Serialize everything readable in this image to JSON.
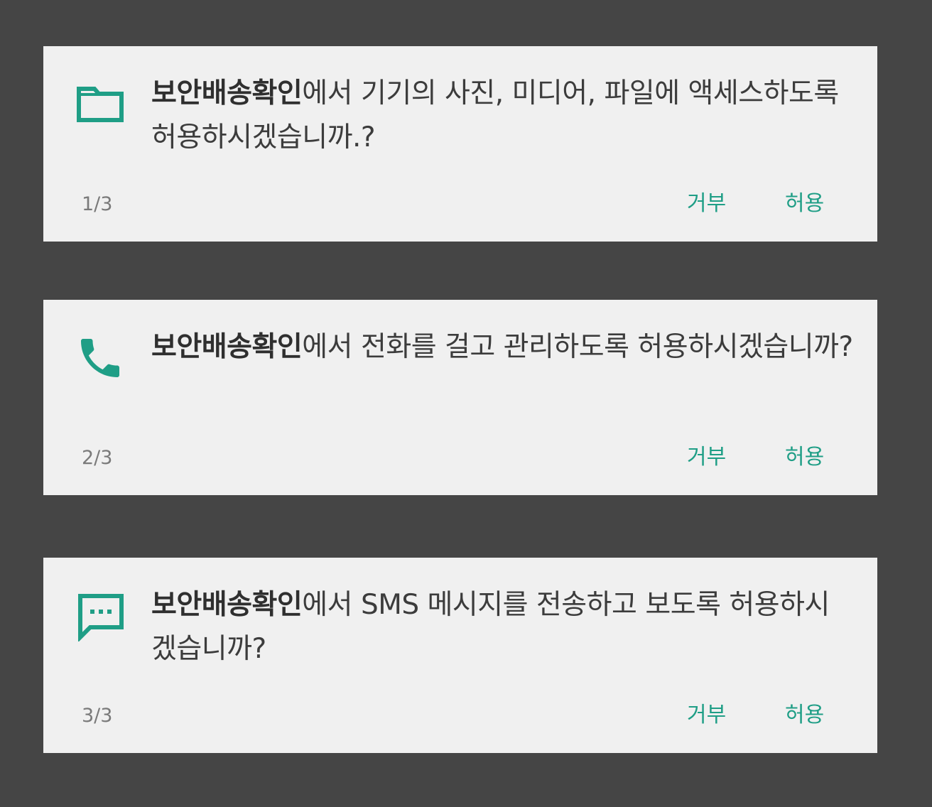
{
  "accent_color": "#1f9e86",
  "dialogs": [
    {
      "icon": "folder-icon",
      "app_name": "보안배송확인",
      "message": "에서 기기의 사진, 미디어, 파일에 액세스하도록 허용하시겠습니까.?",
      "counter": "1/3",
      "deny_label": "거부",
      "allow_label": "허용"
    },
    {
      "icon": "phone-icon",
      "app_name": "보안배송확인",
      "message": "에서 전화를 걸고 관리하도록 허용하시겠습니까?",
      "counter": "2/3",
      "deny_label": "거부",
      "allow_label": "허용"
    },
    {
      "icon": "sms-icon",
      "app_name": "보안배송확인",
      "message": "에서 SMS 메시지를 전송하고 보도록 허용하시겠습니까?",
      "counter": "3/3",
      "deny_label": "거부",
      "allow_label": "허용"
    }
  ]
}
